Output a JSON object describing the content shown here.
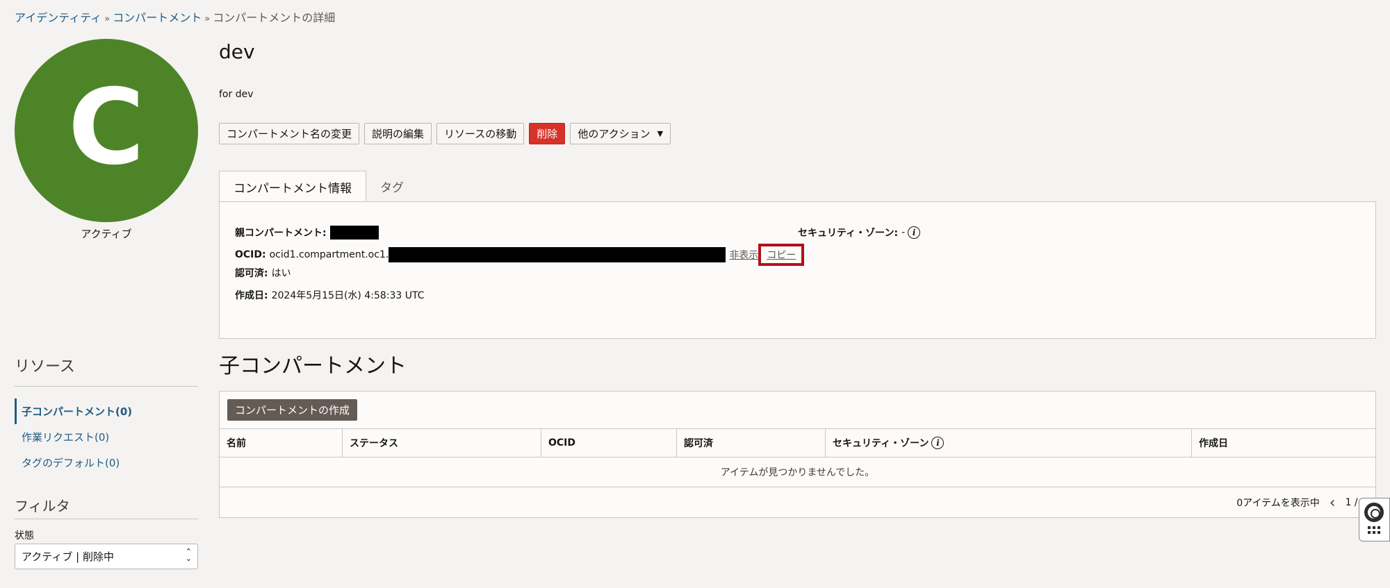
{
  "breadcrumb": {
    "items": [
      "アイデンティティ",
      "コンパートメント"
    ],
    "current": "コンパートメントの詳細",
    "separator": "»"
  },
  "avatar": {
    "letter": "C",
    "color": "#4e8428",
    "status": "アクティブ"
  },
  "compartment": {
    "name": "dev",
    "description": "for dev"
  },
  "actions": {
    "rename": "コンパートメント名の変更",
    "edit_desc": "説明の編集",
    "move": "リソースの移動",
    "delete": "削除",
    "more": "他のアクション"
  },
  "tabs": {
    "info": "コンパートメント情報",
    "tags": "タグ"
  },
  "info": {
    "parent_label": "親コンパートメント:",
    "ocid_label": "OCID:",
    "ocid_prefix": "ocid1.compartment.oc1.",
    "hide_link": "非表示",
    "copy_link": "コピー",
    "authorized_label": "認可済:",
    "authorized_value": "はい",
    "created_label": "作成日:",
    "created_value": "2024年5月15日(水) 4:58:33 UTC",
    "security_zone_label": "セキュリティ・ゾーン:",
    "security_zone_value": "-"
  },
  "child": {
    "title": "子コンパートメント",
    "create_button": "コンパートメントの作成",
    "columns": [
      "名前",
      "ステータス",
      "OCID",
      "認可済",
      "セキュリティ・ゾーン",
      "作成日"
    ],
    "empty_message": "アイテムが見つかりませんでした。",
    "items_shown": "0アイテムを表示中",
    "page": "1 / 1"
  },
  "resources": {
    "title": "リソース",
    "items": [
      "子コンパートメント(0)",
      "作業リクエスト(0)",
      "タグのデフォルト(0)"
    ]
  },
  "filter": {
    "title": "フィルタ",
    "state_label": "状態",
    "state_value": "アクティブ | 削除中"
  },
  "icons": {
    "info": "info-icon",
    "help": "lifebuoy-icon",
    "apps": "grid-icon"
  }
}
